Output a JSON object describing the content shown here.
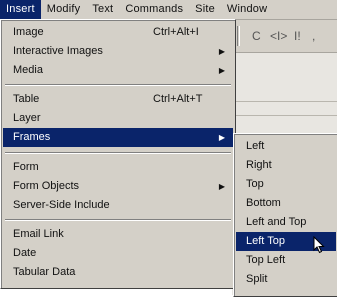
{
  "menubar": {
    "items": [
      "Insert",
      "Modify",
      "Text",
      "Commands",
      "Site",
      "Window"
    ]
  },
  "toolbar_glyphs": [
    "C",
    "<I>",
    "I!",
    ","
  ],
  "insert_menu": {
    "items": [
      {
        "label": "Image",
        "shortcut": "Ctrl+Alt+I",
        "submenu": false
      },
      {
        "label": "Interactive Images",
        "shortcut": "",
        "submenu": true
      },
      {
        "label": "Media",
        "shortcut": "",
        "submenu": true
      },
      {
        "label": "Table",
        "shortcut": "Ctrl+Alt+T",
        "submenu": false
      },
      {
        "label": "Layer",
        "shortcut": "",
        "submenu": false
      },
      {
        "label": "Frames",
        "shortcut": "",
        "submenu": true,
        "highlighted": true
      },
      {
        "label": "Form",
        "shortcut": "",
        "submenu": false
      },
      {
        "label": "Form Objects",
        "shortcut": "",
        "submenu": true
      },
      {
        "label": "Server-Side Include",
        "shortcut": "",
        "submenu": false
      },
      {
        "label": "Email Link",
        "shortcut": "",
        "submenu": false
      },
      {
        "label": "Date",
        "shortcut": "",
        "submenu": false
      },
      {
        "label": "Tabular Data",
        "shortcut": "",
        "submenu": false
      }
    ]
  },
  "frames_submenu": {
    "items": [
      {
        "label": "Left"
      },
      {
        "label": "Right"
      },
      {
        "label": "Top"
      },
      {
        "label": "Bottom"
      },
      {
        "label": "Left and Top"
      },
      {
        "label": "Left Top",
        "highlighted": true
      },
      {
        "label": "Top Left"
      },
      {
        "label": "Split"
      }
    ]
  },
  "colors": {
    "menu_bg": "#d4d0c8",
    "highlight": "#0a246a",
    "highlight_text": "#ffffff"
  }
}
